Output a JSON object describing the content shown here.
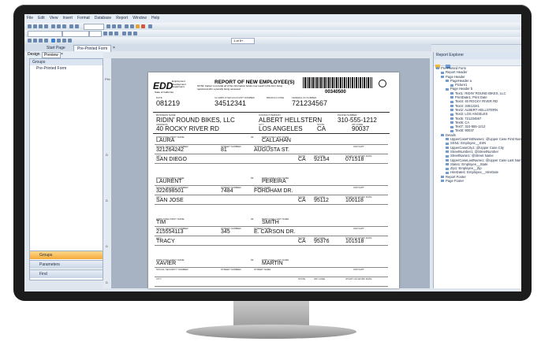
{
  "menu": [
    "File",
    "Edit",
    "View",
    "Insert",
    "Format",
    "Database",
    "Report",
    "Window",
    "Help"
  ],
  "toolbar": {
    "page_counter": "1 of 5+"
  },
  "tabs": {
    "start_page": "Start Page",
    "form_tab": "Pre-Printed Form",
    "close": "×"
  },
  "subtabs": {
    "design": "Design",
    "preview": "Preview",
    "close": "×"
  },
  "left_panel": {
    "header": "Groups",
    "items": [
      "Pre-Printed Form"
    ],
    "nav": [
      "Groups",
      "Parameters",
      "Find"
    ]
  },
  "ruler": {
    "label": "PHr",
    "marks": [
      "D",
      "D",
      "D",
      "D"
    ]
  },
  "form": {
    "logo": "EDD",
    "logo_sub": "Employment Development Department",
    "logo_state": "State of California",
    "title": "REPORT OF NEW EMPLOYEE(S)",
    "note": "NOTE: Failure to provide all of the information below may result in this form being rejected and/or a penalty being assessed.",
    "form_number": "00340500",
    "date_label": "DATE",
    "date": "081219",
    "ca_acct_label": "CA EMPLOYER ACCOUNT NUMBER",
    "ca_acct": "34512341",
    "branch_label": "BRANCH CODE",
    "fein_label": "FEDERAL ID NUMBER",
    "fein": "721234567",
    "business_label": "BUSINESS NAME",
    "business": "RIDIN' ROUND BIKES, LLC",
    "contact_label": "CONTACT PERSON",
    "contact": "ALBERT HELLSTERN",
    "phone_label": "PHONE NUMBER",
    "phone": "310-555-1212",
    "address_label": "ADDRESS",
    "address": "40 ROCKY RIVER RD",
    "city_label": "CITY",
    "city": "LOS ANGELES",
    "state_label": "STATE",
    "state": "CA",
    "zip_label": "ZIP CODE",
    "zip": "90037",
    "emp_labels": {
      "first": "EMPLOYEE FIRST NAME",
      "mi": "MI",
      "last": "EMPLOYEE LAST NAME",
      "ssn": "SOCIAL SECURITY NUMBER",
      "street_number": "STREET NUMBER",
      "street_name": "STREET NAME",
      "unit": "UNIT/APT",
      "city": "CITY",
      "state": "STATE",
      "zip": "ZIP CODE",
      "start": "START-OF-WORK DATE"
    },
    "employees": [
      {
        "first": "LAURA",
        "last": "CALLAHAN",
        "ssn": "321264242",
        "street_number": "81",
        "street_name": "AUGUSTA ST.",
        "city": "SAN DIEGO",
        "state": "CA",
        "zip": "92154",
        "start": "071518"
      },
      {
        "first": "LAURENT",
        "last": "PEREIRA",
        "ssn": "322698501",
        "street_number": "7484",
        "street_name": "FORDHAM DR.",
        "city": "SAN JOSE",
        "state": "CA",
        "zip": "95112",
        "start": "100118"
      },
      {
        "first": "TIM",
        "last": "SMITH",
        "ssn": "215554113",
        "street_number": "345",
        "street_name": "E. CARSON DR.",
        "city": "TRACY",
        "state": "CA",
        "zip": "95376",
        "start": "101518"
      },
      {
        "first": "XAVIER",
        "last": "MARTIN",
        "ssn": "",
        "street_number": "",
        "street_name": "",
        "city": "",
        "state": "",
        "zip": "",
        "start": ""
      }
    ]
  },
  "report_explorer": {
    "header": "Report Explorer",
    "nodes": [
      {
        "level": 0,
        "text": "Pre-Printed Form"
      },
      {
        "level": 1,
        "text": "Report Header"
      },
      {
        "level": 1,
        "text": "Page Header"
      },
      {
        "level": 2,
        "text": "PageHeader a"
      },
      {
        "level": 3,
        "text": "Picture1"
      },
      {
        "level": 2,
        "text": "Page Header b"
      },
      {
        "level": 3,
        "text": "Text1: RIDIN' ROUND BIKES, LLC"
      },
      {
        "level": 3,
        "text": "PrintDate1: Print Date"
      },
      {
        "level": 3,
        "text": "Text4: 40 ROCKY RIVER RD"
      },
      {
        "level": 3,
        "text": "Text4: 34512341"
      },
      {
        "level": 3,
        "text": "Text2: ALBERT HELLSTERN"
      },
      {
        "level": 3,
        "text": "Text3: LOS ANGELES"
      },
      {
        "level": 3,
        "text": "Text5: 721234567"
      },
      {
        "level": 3,
        "text": "Text6: CA"
      },
      {
        "level": 3,
        "text": "Text7: 310-555-1212"
      },
      {
        "level": 3,
        "text": "Text8: 90037"
      },
      {
        "level": 1,
        "text": "Details"
      },
      {
        "level": 2,
        "text": "UpperCaseFirstName1: @Upper Case First Name"
      },
      {
        "level": 2,
        "text": "SSN1: Employee__SSN"
      },
      {
        "level": 2,
        "text": "UpperCaseCity1: @Upper Case City"
      },
      {
        "level": 2,
        "text": "StreetNumber1: @StreetNumber"
      },
      {
        "level": 2,
        "text": "StreetName1: @Street Name"
      },
      {
        "level": 2,
        "text": "UpperCaseLastName1: @Upper Case Last Name"
      },
      {
        "level": 2,
        "text": "State1: Employee__State"
      },
      {
        "level": 2,
        "text": "Zip1: Employee__Zip"
      },
      {
        "level": 2,
        "text": "HireDate1: Employee__HireDate"
      },
      {
        "level": 1,
        "text": "Report Footer"
      },
      {
        "level": 1,
        "text": "Page Footer"
      }
    ]
  }
}
